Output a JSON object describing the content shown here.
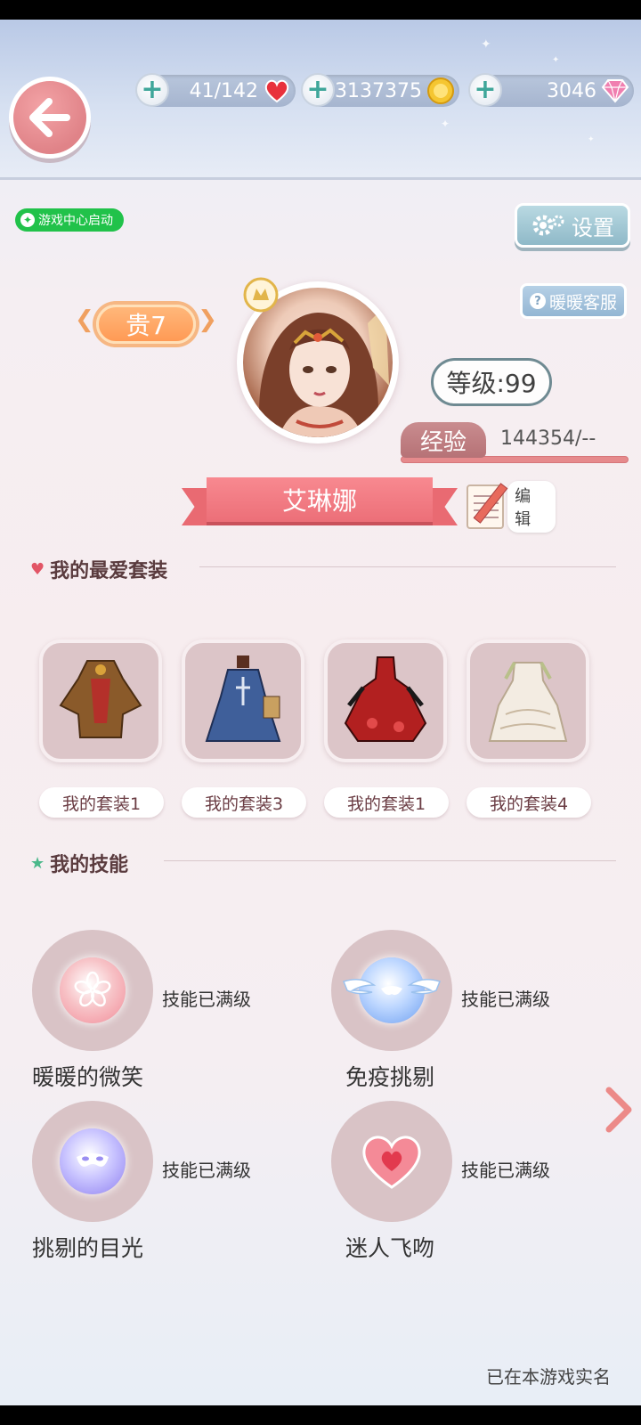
{
  "resources": {
    "stamina": "41/142",
    "coins": "3137375",
    "diamonds": "3046"
  },
  "game_center": "游戏中心启动",
  "settings_label": "设置",
  "customer_service_label": "暖暖客服",
  "profile": {
    "vip": "贵7",
    "level": "等级:99",
    "exp_label": "经验",
    "exp_value": "144354/--",
    "name": "艾琳娜",
    "edit_label": "编 辑"
  },
  "favorites": {
    "title": "我的最爱套装",
    "items": [
      {
        "label": "我的套装1",
        "color": "#8a5a2a"
      },
      {
        "label": "我的套装3",
        "color": "#3f5f9a"
      },
      {
        "label": "我的套装1",
        "color": "#b22020"
      },
      {
        "label": "我的套装4",
        "color": "#f3ece2"
      }
    ]
  },
  "skills": {
    "title": "我的技能",
    "items": [
      {
        "name": "暖暖的微笑",
        "status": "技能已满级",
        "icon": "flower-icon"
      },
      {
        "name": "免疫挑剔",
        "status": "技能已满级",
        "icon": "winged-shield-icon"
      },
      {
        "name": "挑剔的目光",
        "status": "技能已满级",
        "icon": "mask-icon"
      },
      {
        "name": "迷人飞吻",
        "status": "技能已满级",
        "icon": "heart-icon"
      }
    ]
  },
  "footer_note": "已在本游戏实名"
}
